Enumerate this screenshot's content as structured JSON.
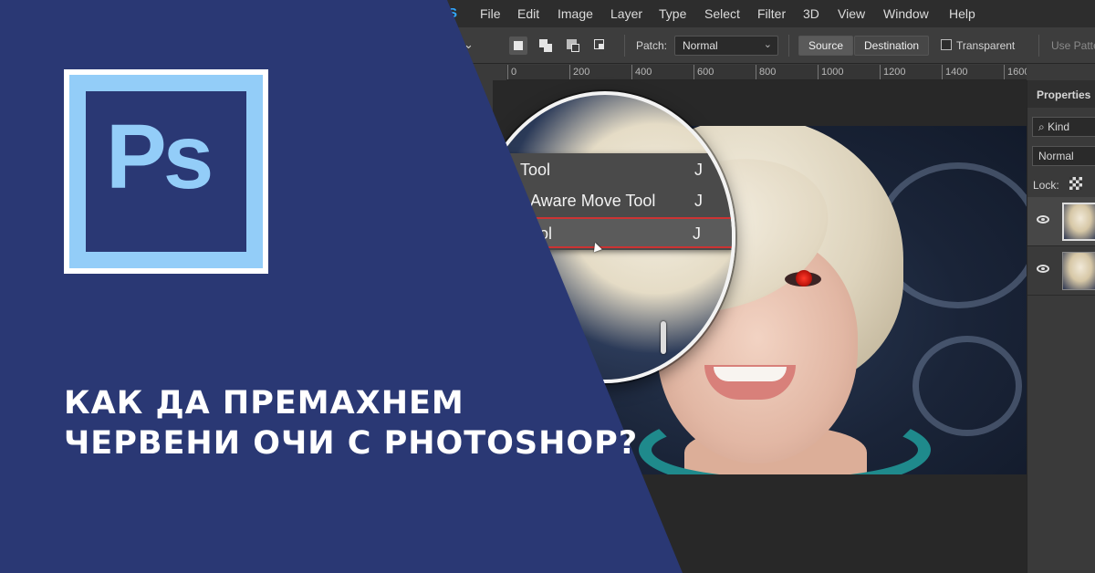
{
  "menubar": {
    "items": [
      "File",
      "Edit",
      "Image",
      "Layer",
      "Type",
      "Select",
      "Filter",
      "3D",
      "View",
      "Window",
      "Help"
    ]
  },
  "options": {
    "patch_label": "Patch:",
    "patch_value": "Normal",
    "source_label": "Source",
    "destination_label": "Destination",
    "transparent_label": "Transparent",
    "use_pattern_label": "Use Patte"
  },
  "ruler": {
    "labels": [
      "0",
      "200",
      "400",
      "600",
      "800",
      "1000",
      "1200",
      "1400",
      "1600"
    ]
  },
  "flyout": {
    "items": [
      {
        "label": "Tool",
        "key": "J"
      },
      {
        "label": "t-Aware Move Tool",
        "key": "J"
      },
      {
        "label": "Tool",
        "key": "J"
      }
    ]
  },
  "panel": {
    "title": "Properties",
    "kind_label": "Kind",
    "blend_mode": "Normal",
    "lock_label": "Lock:"
  },
  "promo": {
    "logo_text": "Ps",
    "headline_line1": "КАК ДА ПРЕМАХНЕМ",
    "headline_line2": "ЧЕРВЕНИ ОЧИ С PHOTOSHOP?",
    "overlay_color": "#2a3874",
    "logo_light": "#93cdf8"
  }
}
